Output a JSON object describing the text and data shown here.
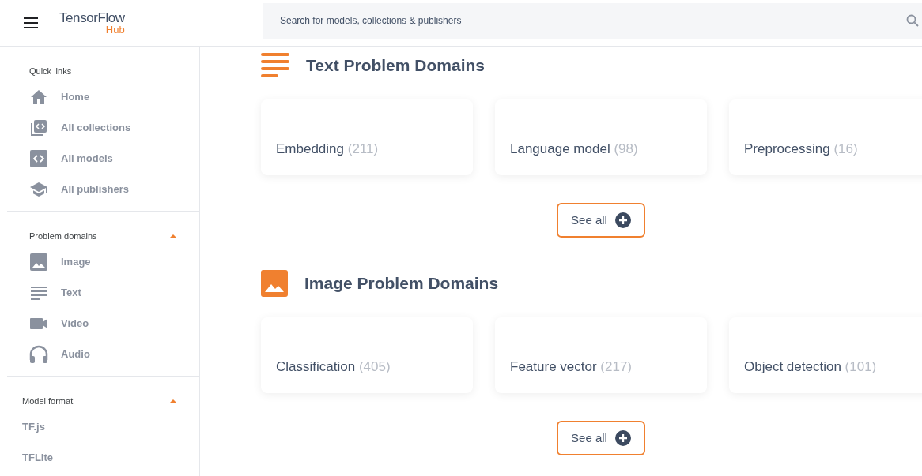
{
  "header": {
    "logo": "TensorFlow",
    "logo_sub": "Hub",
    "search": {
      "placeholder": "Search for models, collections & publishers"
    }
  },
  "sidebar": {
    "sections": [
      {
        "title": "Quick links",
        "items": [
          {
            "label": "Home"
          },
          {
            "label": "All collections"
          },
          {
            "label": "All models"
          },
          {
            "label": "All publishers"
          }
        ]
      },
      {
        "title": "Problem domains",
        "expanded": true,
        "items": [
          {
            "label": "Image"
          },
          {
            "label": "Text"
          },
          {
            "label": "Video"
          },
          {
            "label": "Audio"
          }
        ]
      },
      {
        "title": "Model format",
        "expanded": true,
        "items": [
          {
            "label": "TF.js"
          },
          {
            "label": "TFLite"
          }
        ]
      }
    ]
  },
  "sections": [
    {
      "kind": "text",
      "title": "Text Problem Domains",
      "cards": [
        {
          "label": "Embedding",
          "count": "(211)"
        },
        {
          "label": "Language model",
          "count": "(98)"
        },
        {
          "label": "Preprocessing",
          "count": "(16)"
        }
      ],
      "button": "See all"
    },
    {
      "kind": "image",
      "title": "Image Problem Domains",
      "cards": [
        {
          "label": "Classification",
          "count": "(405)"
        },
        {
          "label": "Feature vector",
          "count": "(217)"
        },
        {
          "label": "Object detection",
          "count": "(101)"
        }
      ],
      "button": "See all"
    }
  ]
}
